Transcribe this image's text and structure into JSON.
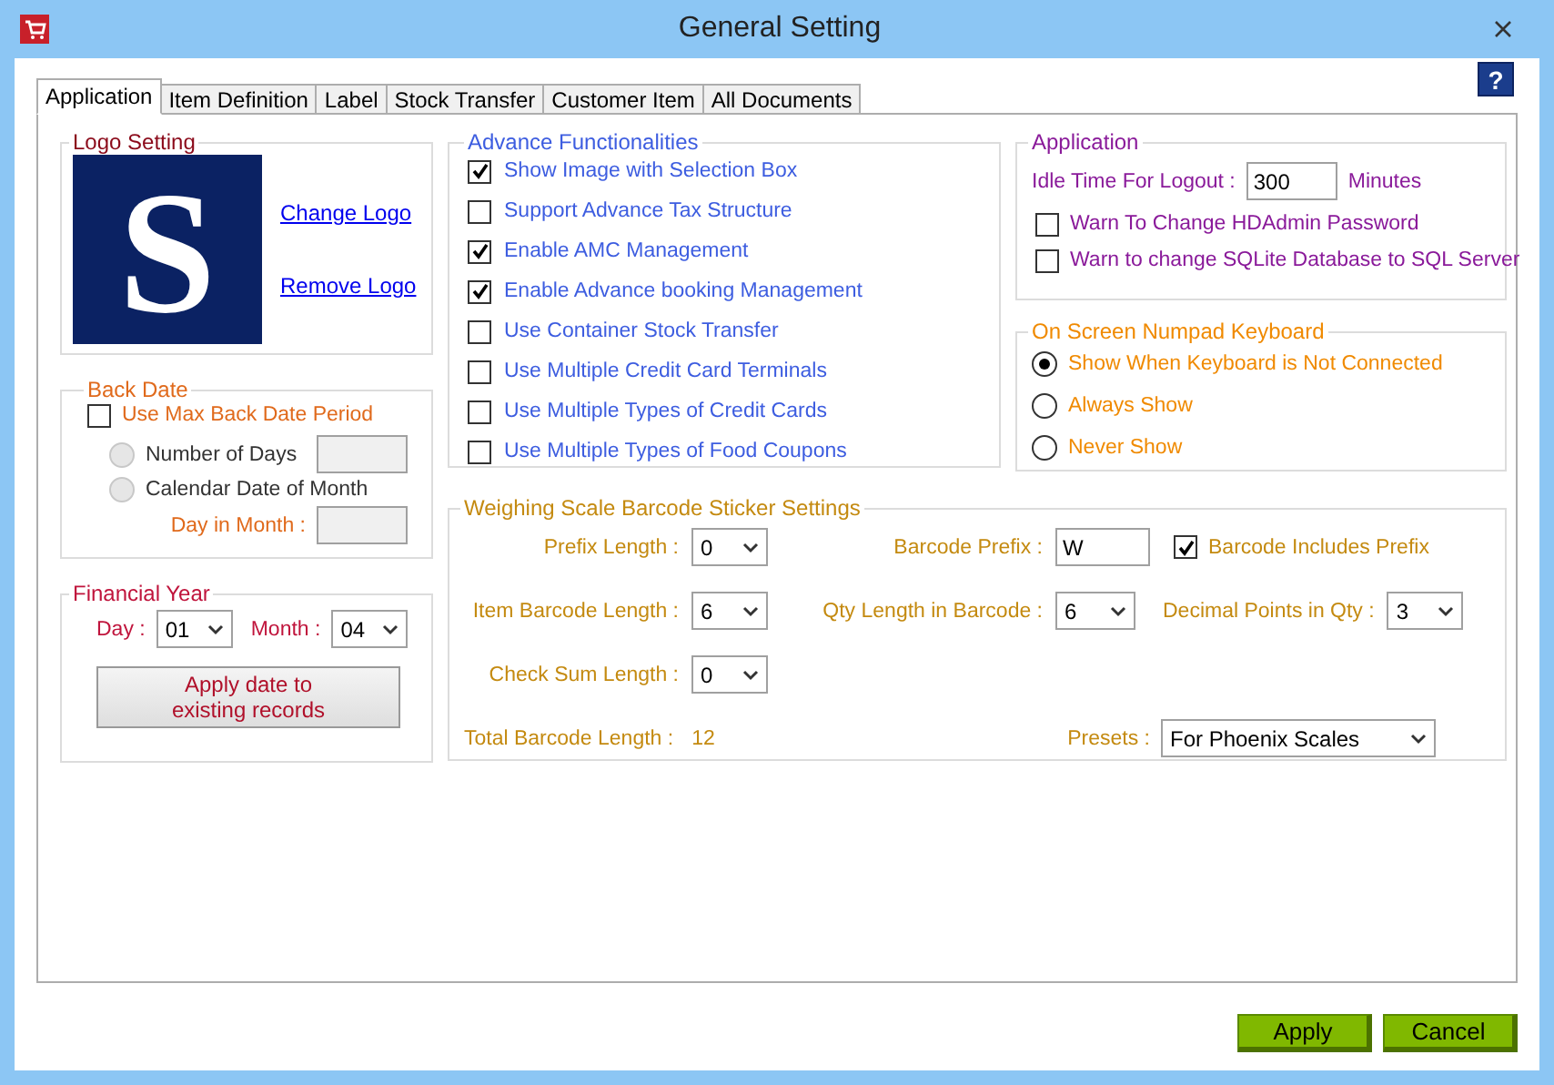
{
  "window": {
    "title": "General Setting"
  },
  "help_button": "?",
  "tabs": [
    {
      "label": "Application",
      "selected": true
    },
    {
      "label": "Item Definition",
      "selected": false
    },
    {
      "label": "Label",
      "selected": false
    },
    {
      "label": "Stock Transfer",
      "selected": false
    },
    {
      "label": "Customer Item",
      "selected": false
    },
    {
      "label": "All Documents",
      "selected": false
    }
  ],
  "logo_setting": {
    "title": "Logo Setting",
    "logo_text": "S",
    "links": [
      "Change Logo",
      "Remove Logo"
    ]
  },
  "back_date": {
    "title": "Back Date",
    "use_max": {
      "label": "Use Max Back Date Period",
      "checked": false
    },
    "options": [
      {
        "label": "Number of Days",
        "selected": false
      },
      {
        "label": "Calendar Date of Month",
        "selected": false
      }
    ],
    "day_in_month": "Day in Month :"
  },
  "financial_year": {
    "title": "Financial Year",
    "day": {
      "label": "Day :",
      "value": "01"
    },
    "month": {
      "label": "Month :",
      "value": "04"
    },
    "apply_button": "Apply date to\nexisting records"
  },
  "advance": {
    "title": "Advance Functionalities",
    "items": [
      {
        "label": "Show Image with Selection Box",
        "checked": true
      },
      {
        "label": "Support Advance Tax Structure",
        "checked": false
      },
      {
        "label": "Enable AMC Management",
        "checked": true
      },
      {
        "label": "Enable Advance booking Management",
        "checked": true
      },
      {
        "label": "Use Container Stock Transfer",
        "checked": false
      },
      {
        "label": "Use Multiple Credit Card Terminals",
        "checked": false
      },
      {
        "label": "Use Multiple Types of Credit Cards",
        "checked": false
      },
      {
        "label": "Use Multiple Types of Food Coupons",
        "checked": false
      }
    ]
  },
  "application": {
    "title": "Application",
    "idle_label": "Idle Time For Logout :",
    "idle_value": "300",
    "idle_unit": "Minutes",
    "warnings": [
      {
        "label": "Warn To Change HDAdmin Password",
        "checked": false
      },
      {
        "label": "Warn to change SQLite Database to SQL Server",
        "checked": false
      }
    ]
  },
  "numpad": {
    "title": "On Screen Numpad Keyboard",
    "options": [
      {
        "label": "Show When Keyboard is Not Connected",
        "selected": true
      },
      {
        "label": "Always Show",
        "selected": false
      },
      {
        "label": "Never Show",
        "selected": false
      }
    ]
  },
  "weighing": {
    "title": "Weighing Scale Barcode Sticker Settings",
    "rows": [
      [
        {
          "kind": "select",
          "label": "Prefix Length :",
          "value": "0"
        },
        {
          "kind": "input",
          "label": "Barcode Prefix :",
          "value": "W"
        },
        {
          "kind": "checkbox",
          "label": "Barcode Includes Prefix",
          "checked": true
        }
      ],
      [
        {
          "kind": "select",
          "label": "Item Barcode Length :",
          "value": "6"
        },
        {
          "kind": "select",
          "label": "Qty Length in Barcode :",
          "value": "6"
        },
        {
          "kind": "select",
          "label": "Decimal Points in Qty :",
          "value": "3"
        }
      ],
      [
        {
          "kind": "select",
          "label": "Check Sum Length :",
          "value": "0"
        }
      ]
    ],
    "total": {
      "label": "Total Barcode Length :",
      "value": "12"
    },
    "presets": {
      "label": "Presets :",
      "value": "For Phoenix Scales"
    }
  },
  "buttons": [
    "Apply",
    "Cancel"
  ]
}
